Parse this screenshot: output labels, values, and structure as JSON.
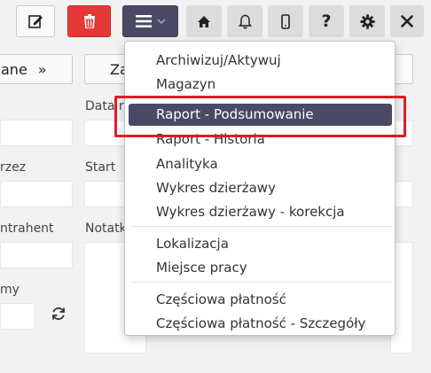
{
  "toolbar": {
    "buttons": [
      {
        "name": "edit",
        "icon": "edit-icon"
      },
      {
        "name": "delete",
        "icon": "trash-icon",
        "color": "#e53935"
      },
      {
        "name": "menu",
        "icon": "hamburger-menu-icon",
        "color": "#4a4a66"
      },
      {
        "name": "home",
        "icon": "home-icon"
      },
      {
        "name": "notifications",
        "icon": "bell-icon"
      },
      {
        "name": "mobile",
        "icon": "mobile-phone-icon"
      },
      {
        "name": "help",
        "icon": "question-icon",
        "label": "?"
      },
      {
        "name": "settings",
        "icon": "gear-icon"
      },
      {
        "name": "close",
        "icon": "close-icon"
      }
    ]
  },
  "background": {
    "btn_left_label": "ane",
    "btn_middle_label": "Za",
    "labels": {
      "data": "Data ro",
      "przez": "rzez",
      "start": "Start",
      "kontrahent": "ntrahent",
      "notatka": "Notatk",
      "my": "my"
    }
  },
  "dropdown": {
    "items": [
      {
        "label": "Archiwizuj/Aktywuj"
      },
      {
        "label": "Magazyn"
      },
      {
        "label": "Raport - Podsumowanie",
        "active": true
      },
      {
        "label": "Raport - Historia"
      },
      {
        "label": "Analityka"
      },
      {
        "label": "Wykres dzierżawy"
      },
      {
        "label": "Wykres dzierżawy - korekcja"
      },
      {
        "label": "Lokalizacja"
      },
      {
        "label": "Miejsce pracy"
      },
      {
        "label": "Częściowa płatność"
      },
      {
        "label": "Częściowa płatność - Szczegóły"
      }
    ]
  },
  "colors": {
    "accent": "#4a4a66",
    "danger": "#e53935",
    "highlight": "#e01b24"
  }
}
